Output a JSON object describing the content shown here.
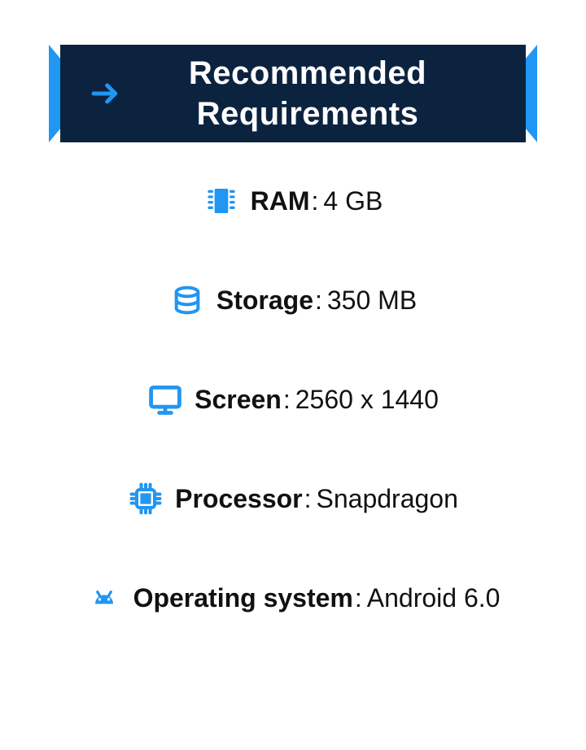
{
  "header": {
    "title": "Recommended Requirements"
  },
  "colors": {
    "accent": "#2196f3",
    "header_bg": "#0c2340"
  },
  "specs": [
    {
      "icon": "ram-icon",
      "label": "RAM",
      "value": "4 GB"
    },
    {
      "icon": "storage-icon",
      "label": "Storage",
      "value": "350 MB"
    },
    {
      "icon": "screen-icon",
      "label": "Screen",
      "value": "2560 x 1440"
    },
    {
      "icon": "processor-icon",
      "label": "Processor",
      "value": "Snapdragon"
    },
    {
      "icon": "os-icon",
      "label": "Operating system",
      "value": "Android 6.0"
    }
  ]
}
